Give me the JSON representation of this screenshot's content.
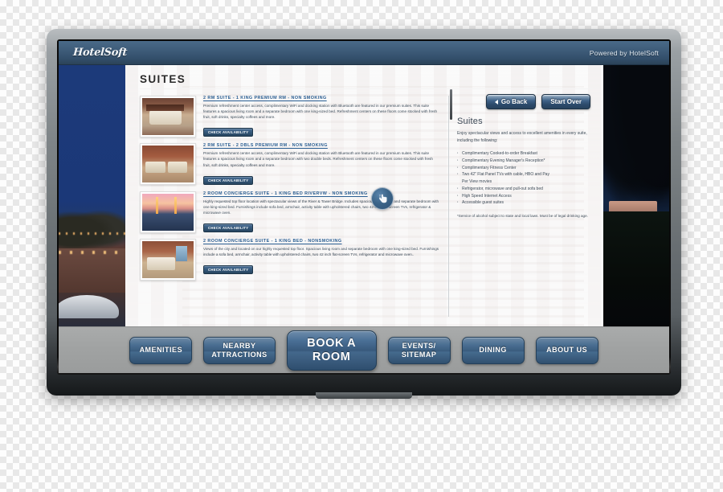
{
  "header": {
    "brand": "HotelSoft",
    "powered_by": "Powered by HotelSoft"
  },
  "top_actions": {
    "go_back": "Go Back",
    "start_over": "Start Over"
  },
  "page": {
    "title": "SUITES"
  },
  "suites": [
    {
      "name": "2 RM SUITE - 1 KING PREMIUM RM - NON SMOKING",
      "description": "Premium refreshment center access, complimentary WiFi and docking station with Bluetooth are featured in our premium suites. This suite features a spacious living room and a separate bedroom with one king-sized bed. Refreshment centers on these floors come stocked with fresh fruit, soft drinks, specialty coffees and more.",
      "button": "CHECK AVAILABILITY",
      "thumb": "king-suite-photo"
    },
    {
      "name": "2 RM SUITE - 2 DBLS PREMIUM RM - NON SMOKING",
      "description": "Premium refreshment center access, complimentary WiFi and docking station with Bluetooth are featured in our premium suites. This suite features a spacious living room and a separate bedroom with two double beds. Refreshment centers on these floors come stocked with fresh fruit, soft drinks, specialty coffees and more.",
      "button": "CHECK AVAILABILITY",
      "thumb": "double-beds-photo"
    },
    {
      "name": "2 ROOM CONCIERGE SUITE - 1 KING BED RIVERVW - NON SMOKING",
      "description": "Highly requested top floor location with spectacular views of the River & Tower Bridge. Includes spacious living room and separate bedroom with one king-sized bed. Furnishings include sofa bed, armchair, activity table with upholstered chairs, two 42-inch flat-screen TVs, refrigerator & microwave oven.",
      "button": "CHECK AVAILABILITY",
      "thumb": "riverview-sunset-photo"
    },
    {
      "name": "2 ROOM CONCIERGE SUITE - 1 KING BED - NONSMOKING",
      "description": "Views of the city and located on our highly requested top floor. Spacious living room and separate bedroom with one king-sized bed. Furnishings include a sofa bed, armchair, activity table with upholstered chairs, two 42 inch flat-screen TVs, refrigerator and microwave oven..",
      "button": "CHECK AVAILABILITY",
      "thumb": "king-suite-window-photo"
    }
  ],
  "info_panel": {
    "heading": "Suites",
    "intro": "Enjoy spectacular views and access to excellent amenities in every suite, including the following:",
    "amenities": [
      "Complimentary Cooked-to-order Breakfast",
      "Complimentary Evening Manager's Reception*",
      "Complimentary Fitness Center",
      "Two 42\" Flat Panel TVs with cable, HBO and Pay",
      "Per View movies",
      "Refrigerator, microwave and pull-out sofa bed",
      "High Speed Internet Access",
      "Accessible guest suites"
    ],
    "footnote": "*Service of alcohol subject to state and local laws. Must be of legal drinking age."
  },
  "bottom_nav": [
    {
      "label": "AMENITIES",
      "featured": false
    },
    {
      "label": "NEARBY\nATTRACTIONS",
      "featured": false
    },
    {
      "label": "BOOK A\nROOM",
      "featured": true
    },
    {
      "label": "EVENTS/\nSITEMAP",
      "featured": false
    },
    {
      "label": "DINING",
      "featured": false
    },
    {
      "label": "ABOUT US",
      "featured": false
    }
  ],
  "colors": {
    "header_blue": "#3e5c79",
    "link_blue": "#2b5f93",
    "button_blue": "#3a5c7e",
    "bottom_bar_gray": "#a0a2a2"
  },
  "icons": {
    "back_arrow": "triangle-left",
    "touch_cursor": "pointing-hand"
  }
}
